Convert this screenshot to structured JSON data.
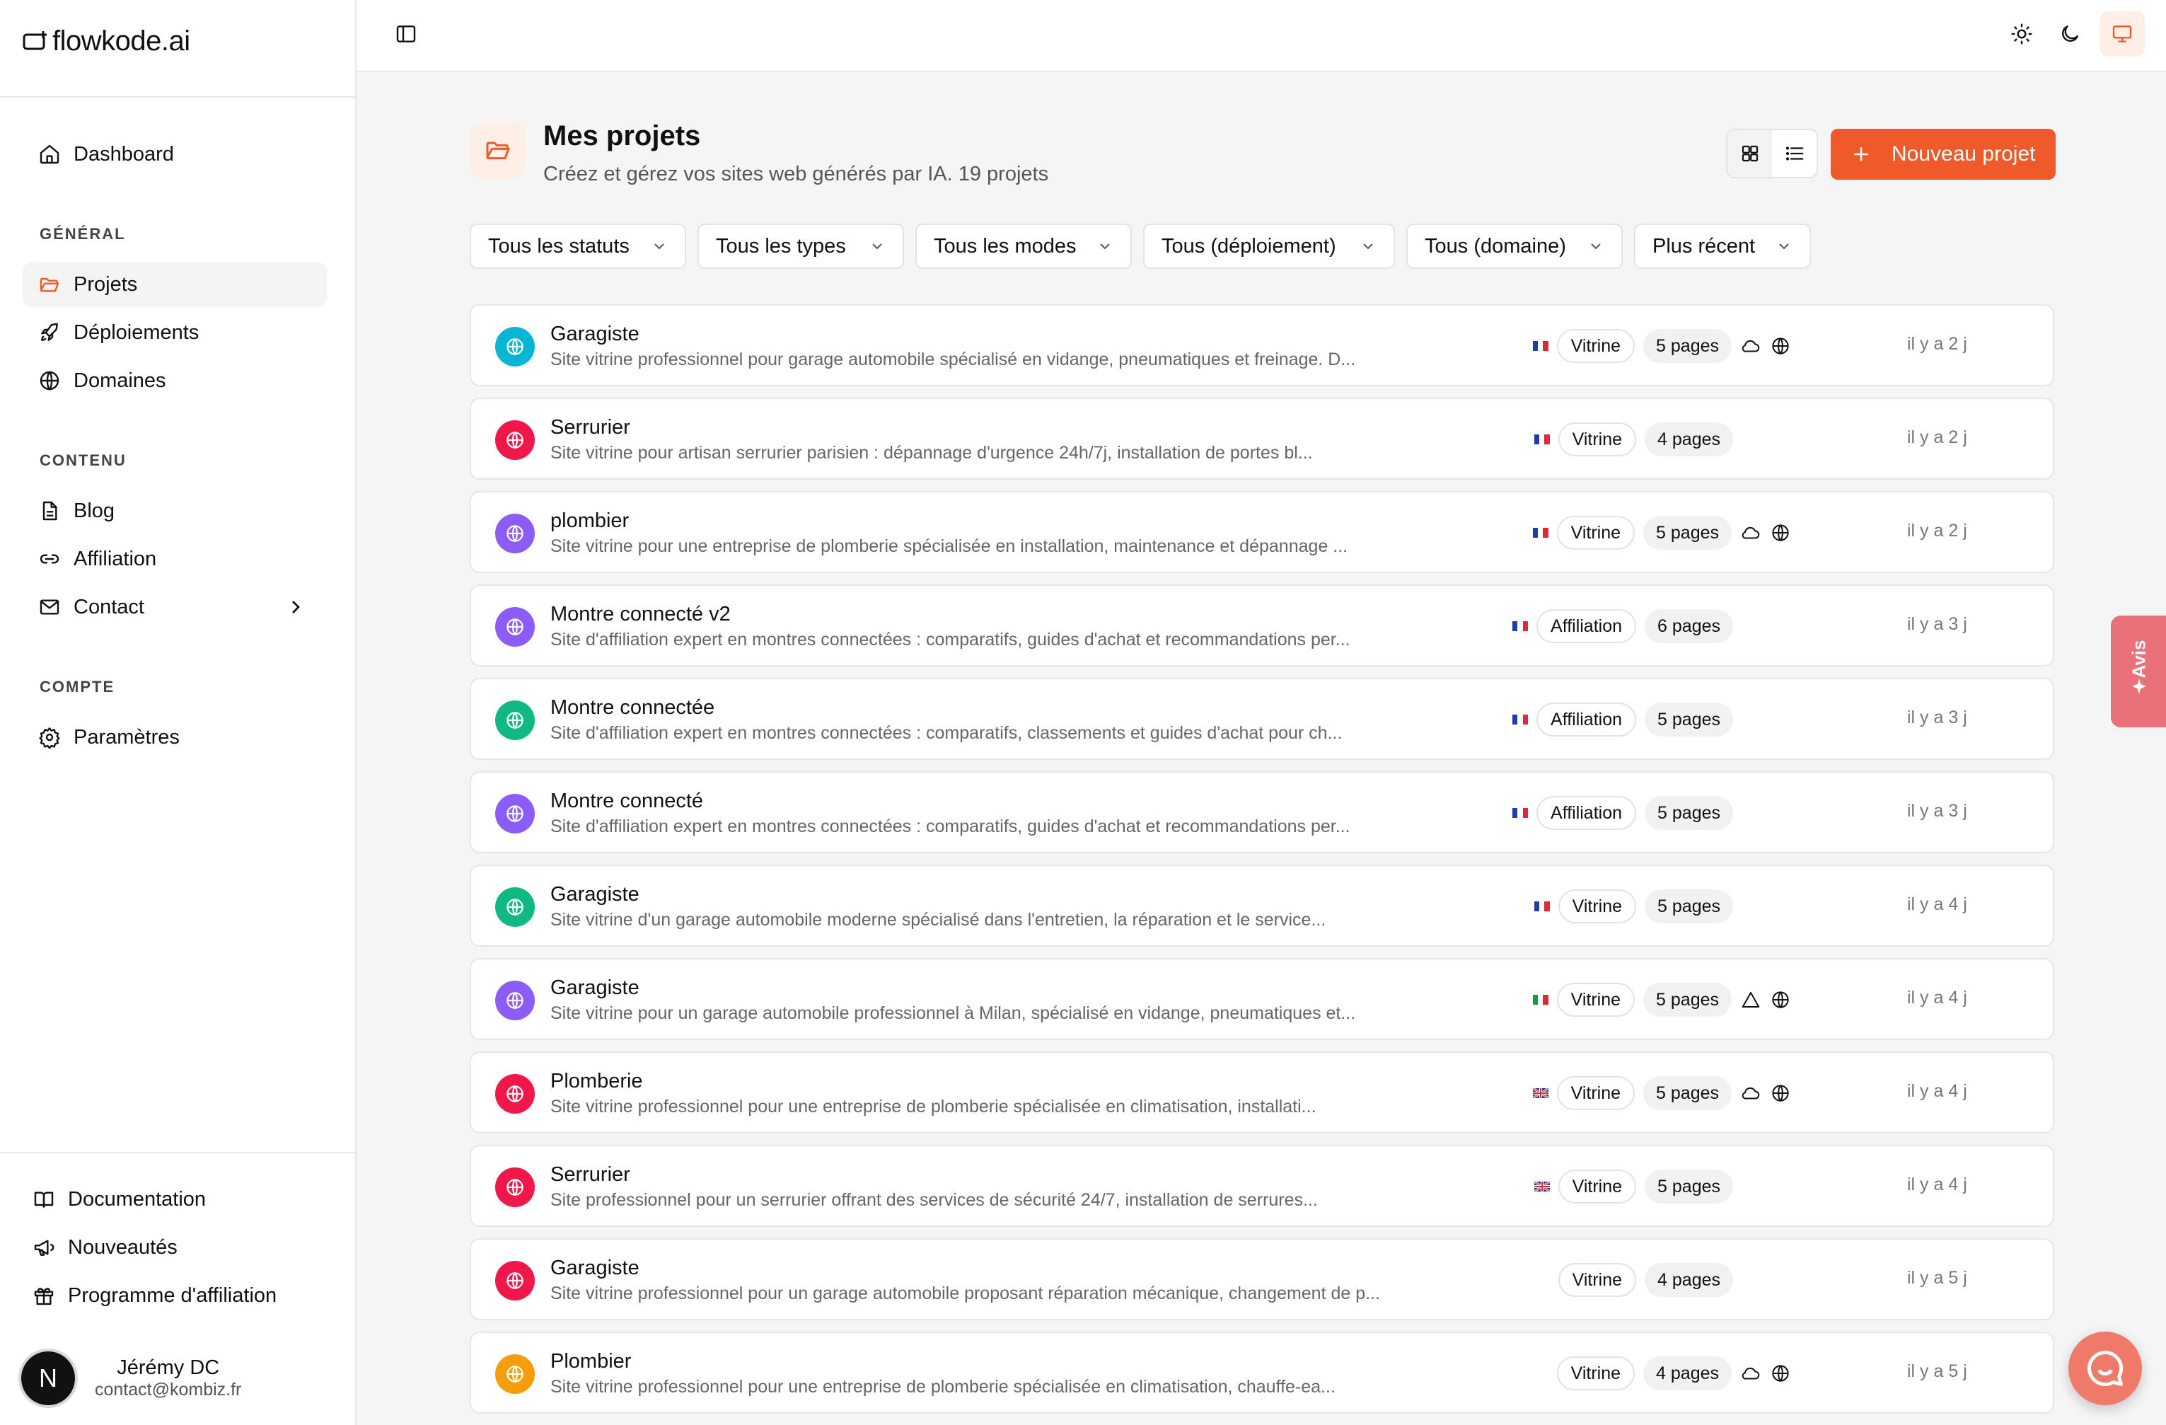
{
  "app": {
    "logo_text": "flowkode.ai"
  },
  "sidebar": {
    "dashboard": "Dashboard",
    "sections": {
      "general": "GÉNÉRAL",
      "content": "CONTENU",
      "account": "COMPTE"
    },
    "items": {
      "projects": "Projets",
      "deployments": "Déploiements",
      "domains": "Domaines",
      "blog": "Blog",
      "affiliation": "Affiliation",
      "contact": "Contact",
      "settings": "Paramètres"
    },
    "footer": {
      "docs": "Documentation",
      "news": "Nouveautés",
      "affiliate_program": "Programme d'affiliation"
    },
    "user": {
      "initial": "N",
      "name": "Jérémy DC",
      "email": "contact@kombiz.fr"
    }
  },
  "header": {
    "title": "Mes projets",
    "subtitle": "Créez et gérez vos sites web générés par IA. 19 projets",
    "new_project": "Nouveau projet"
  },
  "filters": {
    "status": "Tous les statuts",
    "types": "Tous les types",
    "modes": "Tous les modes",
    "deployment": "Tous (déploiement)",
    "domain": "Tous (domaine)",
    "sort": "Plus récent"
  },
  "colors": {
    "accent": "#f05a2a",
    "cyan": "#06b6d4",
    "rose": "#f0184a",
    "violet": "#8b5cf6",
    "emerald": "#10b981",
    "orange": "#f59e0b"
  },
  "projects": [
    {
      "name": "Garagiste",
      "desc": "Site vitrine professionnel pour garage automobile spécialisé en vidange, pneumatiques et freinage. D...",
      "flag": "fr",
      "type": "Vitrine",
      "pages": "5 pages",
      "icons": [
        "cloud-icon",
        "globe-icon"
      ],
      "time": "il y a 2 j",
      "color": "#06b6d4"
    },
    {
      "name": "Serrurier",
      "desc": "Site vitrine pour artisan serrurier parisien : dépannage d'urgence 24h/7j, installation de portes bl...",
      "flag": "fr",
      "type": "Vitrine",
      "pages": "4 pages",
      "icons": [],
      "time": "il y a 2 j",
      "color": "#f0184a"
    },
    {
      "name": "plombier",
      "desc": "Site vitrine pour une entreprise de plomberie spécialisée en installation, maintenance et dépannage ...",
      "flag": "fr",
      "type": "Vitrine",
      "pages": "5 pages",
      "icons": [
        "cloud-icon",
        "globe-icon"
      ],
      "time": "il y a 2 j",
      "color": "#8b5cf6"
    },
    {
      "name": "Montre connecté v2",
      "desc": "Site d'affiliation expert en montres connectées : comparatifs, guides d'achat et recommandations per...",
      "flag": "fr",
      "type": "Affiliation",
      "pages": "6 pages",
      "icons": [],
      "time": "il y a 3 j",
      "color": "#8b5cf6"
    },
    {
      "name": "Montre connectée",
      "desc": "Site d'affiliation expert en montres connectées : comparatifs, classements et guides d'achat pour ch...",
      "flag": "fr",
      "type": "Affiliation",
      "pages": "5 pages",
      "icons": [],
      "time": "il y a 3 j",
      "color": "#10b981"
    },
    {
      "name": "Montre connecté",
      "desc": "Site d'affiliation expert en montres connectées : comparatifs, guides d'achat et recommandations per...",
      "flag": "fr",
      "type": "Affiliation",
      "pages": "5 pages",
      "icons": [],
      "time": "il y a 3 j",
      "color": "#8b5cf6"
    },
    {
      "name": "Garagiste",
      "desc": "Site vitrine d'un garage automobile moderne spécialisé dans l'entretien, la réparation et le service...",
      "flag": "fr",
      "type": "Vitrine",
      "pages": "5 pages",
      "icons": [],
      "time": "il y a 4 j",
      "color": "#10b981"
    },
    {
      "name": "Garagiste",
      "desc": "Site vitrine pour un garage automobile professionnel à Milan, spécialisé en vidange, pneumatiques et...",
      "flag": "it",
      "type": "Vitrine",
      "pages": "5 pages",
      "icons": [
        "triangle-icon",
        "globe-icon"
      ],
      "time": "il y a 4 j",
      "color": "#8b5cf6"
    },
    {
      "name": "Plomberie",
      "desc": "Site vitrine professionnel pour une entreprise de plomberie spécialisée en climatisation, installati...",
      "flag": "gb",
      "type": "Vitrine",
      "pages": "5 pages",
      "icons": [
        "cloud-icon",
        "globe-icon"
      ],
      "time": "il y a 4 j",
      "color": "#f0184a"
    },
    {
      "name": "Serrurier",
      "desc": "Site professionnel pour un serrurier offrant des services de sécurité 24/7, installation de serrures...",
      "flag": "gb",
      "type": "Vitrine",
      "pages": "5 pages",
      "icons": [],
      "time": "il y a 4 j",
      "color": "#f0184a"
    },
    {
      "name": "Garagiste",
      "desc": "Site vitrine professionnel pour un garage automobile proposant réparation mécanique, changement de p...",
      "flag": "",
      "type": "Vitrine",
      "pages": "4 pages",
      "icons": [],
      "time": "il y a 5 j",
      "color": "#f0184a"
    },
    {
      "name": "Plombier",
      "desc": "Site vitrine professionnel pour une entreprise de plomberie spécialisée en climatisation, chauffe-ea...",
      "flag": "",
      "type": "Vitrine",
      "pages": "4 pages",
      "icons": [
        "cloud-icon",
        "globe-icon"
      ],
      "time": "il y a 5 j",
      "color": "#f59e0b"
    }
  ],
  "feedback_tab": "Avis"
}
